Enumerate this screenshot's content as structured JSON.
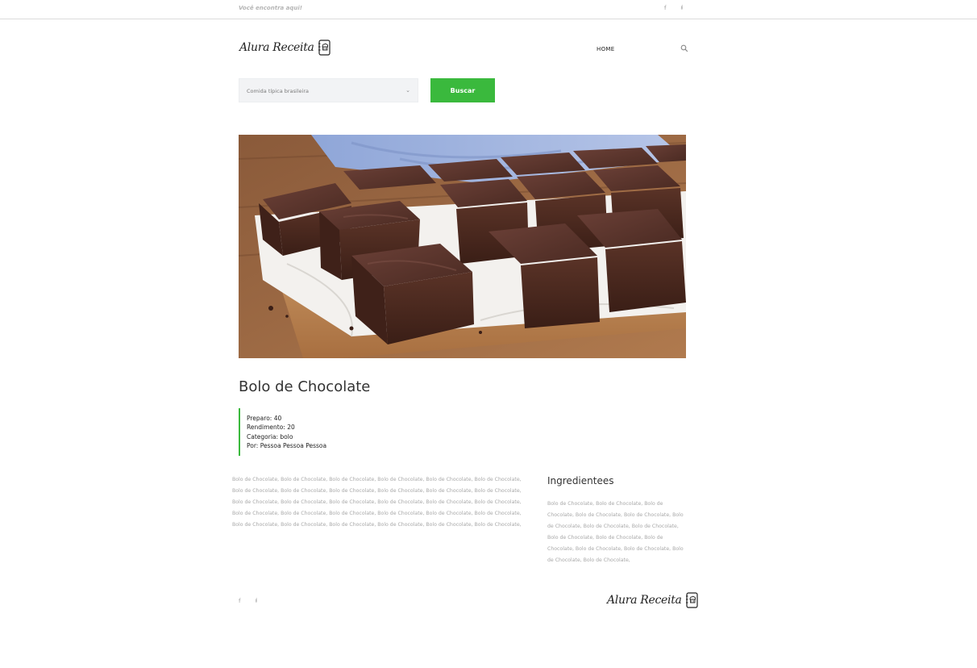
{
  "topbar": {
    "tagline": "Você encontra aqui!",
    "social": {
      "facebook": "f",
      "twitter": "ᵮ"
    }
  },
  "header": {
    "logo_text": "Alura Receita",
    "logo_icon": "cookbook-chef-icon",
    "nav": {
      "home": "HOME"
    },
    "search_icon": "search-icon"
  },
  "search": {
    "selected_option": "Comida típica brasileira",
    "button_label": "Buscar"
  },
  "recipe": {
    "image_alt": "chocolate-brownie-image",
    "title": "Bolo de Chocolate",
    "meta": {
      "preparo": "Preparo: 40",
      "rendimento": "Rendimento: 20",
      "categoria": "Categoria: bolo",
      "autor": "Por: Pessoa Pessoa Pessoa"
    },
    "description_lines": [
      "Bolo de Chocolate, Bolo de Chocolate, Bolo de Chocolate, Bolo de Chocolate, Bolo de Chocolate, Bolo de Chocolate,",
      "Bolo de Chocolate, Bolo de Chocolate, Bolo de Chocolate, Bolo de Chocolate, Bolo de Chocolate, Bolo de Chocolate,",
      "Bolo de Chocolate, Bolo de Chocolate, Bolo de Chocolate, Bolo de Chocolate, Bolo de Chocolate, Bolo de Chocolate,",
      "Bolo de Chocolate, Bolo de Chocolate, Bolo de Chocolate, Bolo de Chocolate, Bolo de Chocolate, Bolo de Chocolate,",
      "Bolo de Chocolate, Bolo de Chocolate, Bolo de Chocolate, Bolo de Chocolate, Bolo de Chocolate, Bolo de Chocolate,"
    ],
    "ingredients_title": "Ingredientees",
    "ingredients_lines": [
      "Bolo de Chocolate, Bolo de Chocolate, Bolo de",
      "Chocolate, Bolo de Chocolate, Bolo de Chocolate, Bolo",
      "de Chocolate, Bolo de Chocolate, Bolo de Chocolate,",
      "Bolo de Chocolate, Bolo de Chocolate, Bolo de",
      "Chocolate, Bolo de Chocolate, Bolo de Chocolate, Bolo",
      "de Chocolate, Bolo de Chocolate,"
    ]
  },
  "footer": {
    "social": {
      "facebook": "f",
      "twitter": "ᵮ"
    },
    "logo_text": "Alura Receita"
  },
  "colors": {
    "accent_green": "#3ab93d",
    "muted_text": "#a8a8a8",
    "select_bg": "#f2f3f5"
  }
}
